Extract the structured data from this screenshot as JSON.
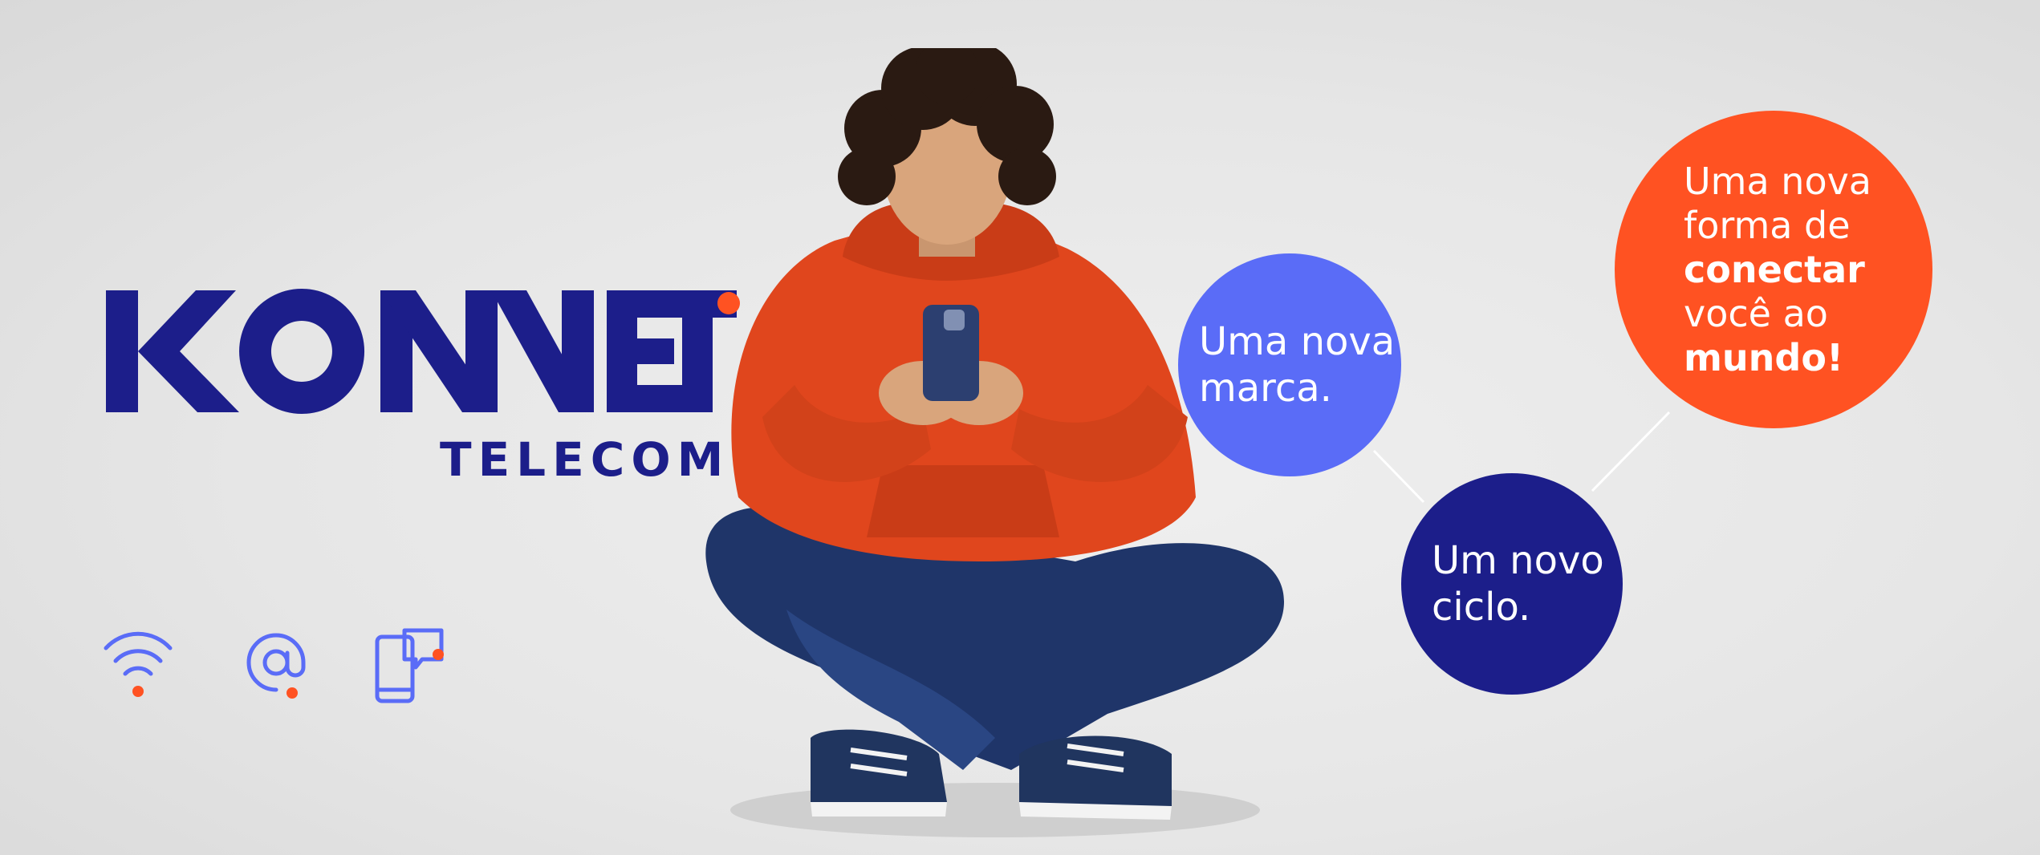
{
  "brand": {
    "name": "KONNET",
    "sub": "TELECOM",
    "color_primary": "#1c1e8a",
    "color_accent": "#ff5222"
  },
  "icons": [
    {
      "name": "wifi-icon"
    },
    {
      "name": "at-sign-icon"
    },
    {
      "name": "mobile-chat-icon"
    }
  ],
  "bubbles": {
    "brand": {
      "line1": "Uma nova",
      "line2": "marca.",
      "color": "#5a6cf7"
    },
    "cycle": {
      "line1": "Um novo",
      "line2": "ciclo.",
      "color": "#1c1e8a"
    },
    "connect": {
      "line1": "Uma nova",
      "line2": "forma de",
      "line3": "conectar",
      "line4": "você ao",
      "line5": "mundo!",
      "color": "#ff5222"
    }
  },
  "colors": {
    "icon_blue": "#5a6cf7",
    "hoodie": "#e0461d",
    "jeans": "#1f3569",
    "background": "#e8e8e8"
  }
}
